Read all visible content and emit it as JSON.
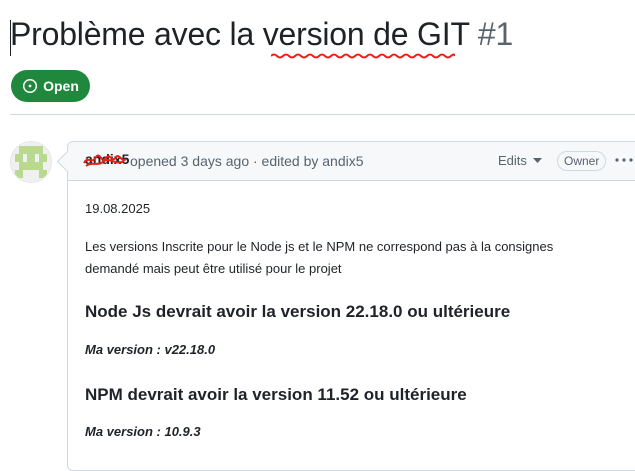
{
  "issue": {
    "title": "Problème avec la version de GIT",
    "number": "#1",
    "state_label": "Open",
    "state_color": "#1f883d"
  },
  "comment": {
    "author": "andix5",
    "meta": "opened 3 days ago · edited by andix5",
    "edits_label": "Edits",
    "role_badge": "Owner",
    "body": {
      "date": "19.08.2025",
      "paragraph": "Les versions Inscrite pour le Node js et le NPM ne correspond pas à la consignes demandé mais peut être utilisé pour le projet",
      "heading_node": "Node Js devrait avoir la version 22.18.0 ou ultérieure",
      "node_version": "Ma version : v22.18.0",
      "heading_npm": "NPM devrait avoir la version 11.52 ou ultérieure",
      "npm_version": "Ma version : 10.9.3"
    }
  },
  "icons": {
    "state": "issue-opened-icon",
    "edits": "triangle-down-icon",
    "more": "kebab-horizontal-icon"
  }
}
